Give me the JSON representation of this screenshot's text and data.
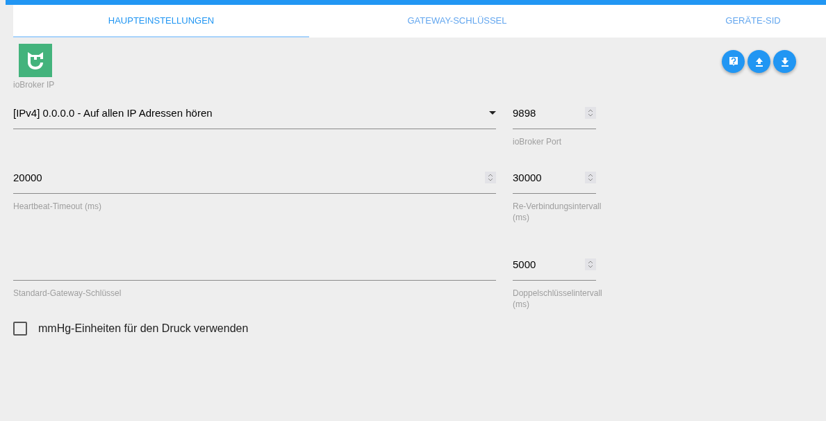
{
  "tabs": [
    {
      "label": "HAUPTEINSTELLUNGEN",
      "selected": true
    },
    {
      "label": "GATEWAY-SCHLÜSSEL",
      "selected": false
    },
    {
      "label": "GERÄTE-SID",
      "selected": false
    }
  ],
  "toolbar": {
    "buttons": [
      {
        "kind": "help"
      },
      {
        "kind": "upload"
      },
      {
        "kind": "download"
      }
    ]
  },
  "logo_caption": "ioBroker IP",
  "rows": [
    {
      "left": {
        "kind": "select",
        "value": "[IPv4] 0.0.0.0 - Auf allen IP Adressen hören"
      },
      "right": {
        "kind": "number",
        "value": "9898",
        "label": "ioBroker Port"
      }
    },
    {
      "left": {
        "kind": "number",
        "value": "20000",
        "label": "Heartbeat-Timeout (ms)"
      },
      "right": {
        "kind": "number",
        "value": "30000",
        "label": "Re-Verbindungsintervall (ms)"
      }
    },
    {
      "left": {
        "kind": "text",
        "label": "Standard-Gateway-Schlüssel"
      },
      "right": {
        "kind": "number",
        "value": "5000",
        "label": "Doppelschlüsselintervall (ms)"
      }
    }
  ],
  "checkbox": {
    "label": "mmHg-Einheiten für den Druck verwenden",
    "checked": false
  }
}
